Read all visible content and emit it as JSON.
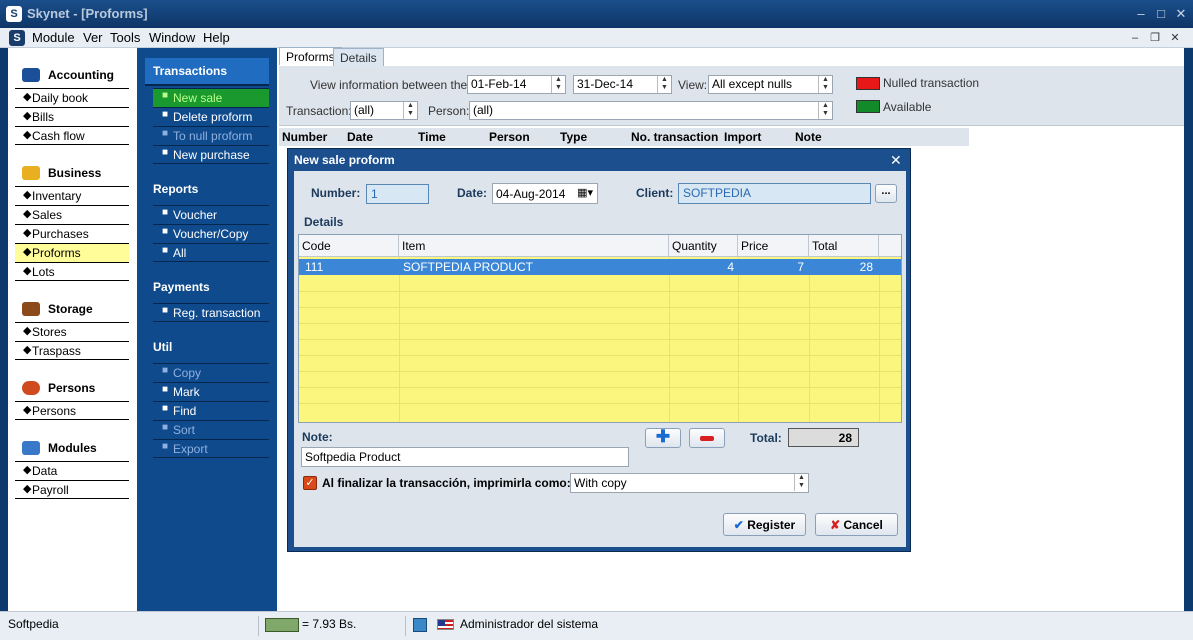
{
  "window": {
    "title": "Skynet - [Proforms]",
    "app_icon": "S"
  },
  "menu": [
    "Module",
    "Ver",
    "Tools",
    "Window",
    "Help"
  ],
  "left_nav": {
    "categories": [
      {
        "label": "Accounting",
        "color": "#1b4f9a",
        "items": [
          "Daily book",
          "Bills",
          "Cash flow"
        ]
      },
      {
        "label": "Business",
        "color": "#e8b020",
        "items": [
          "Inventary",
          "Sales",
          "Purchases",
          "Proforms",
          "Lots"
        ]
      },
      {
        "label": "Storage",
        "color": "#8a4a1a",
        "items": [
          "Stores",
          "Traspass"
        ]
      },
      {
        "label": "Persons",
        "color": "#d04a20",
        "items": [
          "Persons"
        ]
      },
      {
        "label": "Modules",
        "color": "#3a78c8",
        "items": [
          "Data",
          "Payroll"
        ]
      }
    ],
    "selected": "Proforms"
  },
  "mid_nav": {
    "transactions": {
      "title": "Transactions",
      "items": [
        "New sale",
        "Delete proform",
        "To null proform",
        "New purchase"
      ]
    },
    "reports": {
      "title": "Reports",
      "items": [
        "Voucher",
        "Voucher/Copy",
        "All"
      ]
    },
    "payments": {
      "title": "Payments",
      "items": [
        "Reg. transaction"
      ]
    },
    "util": {
      "title": "Util",
      "items": [
        "Copy",
        "Mark",
        "Find",
        "Sort",
        "Export"
      ]
    }
  },
  "tabs": [
    "Proforms",
    "Details"
  ],
  "filters": {
    "view_between_label": "View information between these",
    "date_from": "01-Feb-14",
    "date_to": "31-Dec-14",
    "view_label": "View:",
    "view_value": "All except nulls",
    "transaction_label": "Transaction:",
    "transaction_value": "(all)",
    "person_label": "Person:",
    "person_value": "(all)",
    "legend": [
      {
        "label": "Nulled transaction",
        "color": "#e81818"
      },
      {
        "label": "Available",
        "color": "#138a2a"
      }
    ]
  },
  "grid_headers": [
    "Number",
    "Date",
    "Time",
    "Person",
    "Type",
    "No. transaction",
    "Import",
    "Note"
  ],
  "dialog": {
    "title": "New sale proform",
    "number_label": "Number:",
    "number_value": "1",
    "date_label": "Date:",
    "date_value": "04-Aug-2014",
    "client_label": "Client:",
    "client_value": "SOFTPEDIA",
    "browse_label": "...",
    "details_label": "Details",
    "columns": [
      "Code",
      "Item",
      "Quantity",
      "Price",
      "Total"
    ],
    "rows": [
      {
        "code": "111",
        "item": "SOFTPEDIA PRODUCT",
        "quantity": "4",
        "price": "7",
        "total": "28"
      }
    ],
    "note_label": "Note:",
    "note_value": "Softpedia Product",
    "total_label": "Total:",
    "total_value": "28",
    "print_label": "Al finalizar la transacción, imprimirla como:",
    "print_value": "With copy",
    "register_label": "Register",
    "cancel_label": "Cancel"
  },
  "status": {
    "left": "Softpedia",
    "rate": "= 7.93 Bs.",
    "user": "Administrador del sistema"
  }
}
